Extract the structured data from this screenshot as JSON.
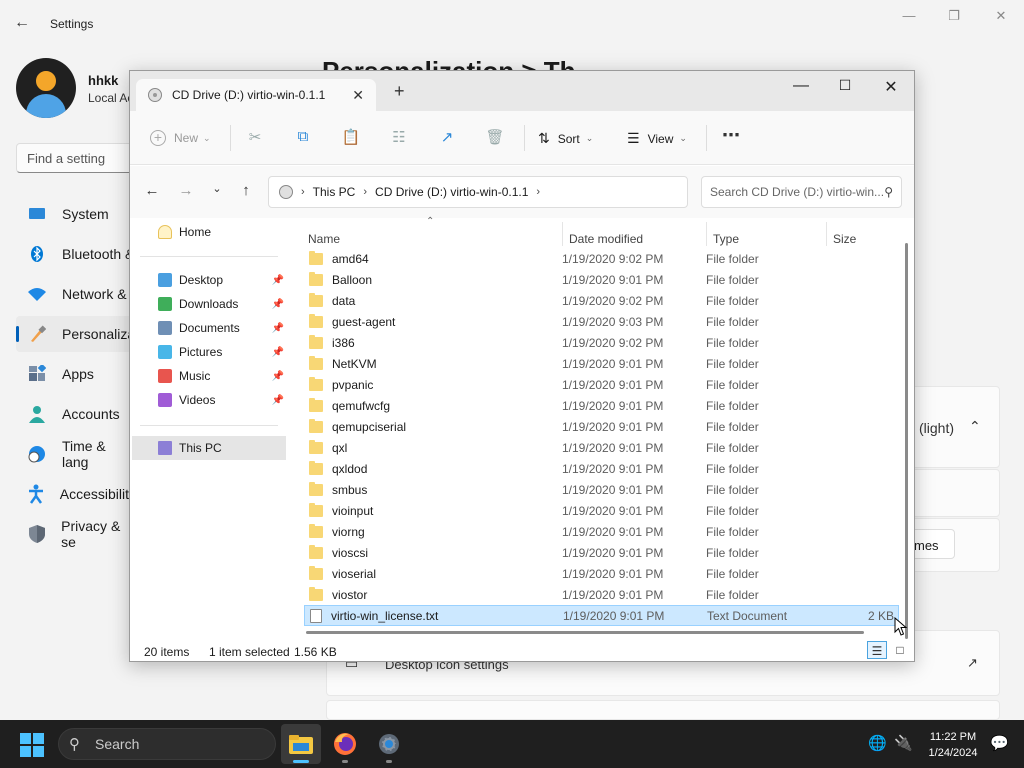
{
  "settings": {
    "title": "Settings",
    "user_name": "hhkk",
    "user_sub": "Local Ac",
    "find_placeholder": "Find a setting",
    "page_heading": "Personalization > Th",
    "nav": [
      {
        "label": "System",
        "icon": "monitor-icon"
      },
      {
        "label": "Bluetooth &",
        "icon": "bluetooth-icon"
      },
      {
        "label": "Network &",
        "icon": "wifi-icon"
      },
      {
        "label": "Personaliza",
        "icon": "brush-icon"
      },
      {
        "label": "Apps",
        "icon": "apps-icon"
      },
      {
        "label": "Accounts",
        "icon": "person-icon"
      },
      {
        "label": "Time & lang",
        "icon": "clock-globe-icon"
      },
      {
        "label": "Accessibility",
        "icon": "accessibility-icon"
      },
      {
        "label": "Privacy & se",
        "icon": "shield-icon"
      }
    ],
    "theme_value": "(light)",
    "themes_button": "mes",
    "desktop_icon_settings": "Desktop icon settings"
  },
  "explorer": {
    "tab_title": "CD Drive (D:) virtio-win-0.1.1",
    "toolbar": {
      "new_label": "New",
      "sort_label": "Sort",
      "view_label": "View"
    },
    "address": {
      "segments": [
        "This PC",
        "CD Drive (D:) virtio-win-0.1.1"
      ]
    },
    "search_placeholder": "Search CD Drive (D:) virtio-win...",
    "nav_pane": {
      "home": "Home",
      "quick": [
        {
          "label": "Desktop",
          "color": "#4a9fe0"
        },
        {
          "label": "Downloads",
          "color": "#3fae5a"
        },
        {
          "label": "Documents",
          "color": "#6f8fb5"
        },
        {
          "label": "Pictures",
          "color": "#48b6e8"
        },
        {
          "label": "Music",
          "color": "#e8554e"
        },
        {
          "label": "Videos",
          "color": "#a05cd6"
        }
      ],
      "this_pc": "This PC"
    },
    "columns": {
      "name": "Name",
      "date": "Date modified",
      "type": "Type",
      "size": "Size"
    },
    "files": [
      {
        "name": "amd64",
        "date": "1/19/2020 9:02 PM",
        "type": "File folder",
        "size": ""
      },
      {
        "name": "Balloon",
        "date": "1/19/2020 9:01 PM",
        "type": "File folder",
        "size": ""
      },
      {
        "name": "data",
        "date": "1/19/2020 9:02 PM",
        "type": "File folder",
        "size": ""
      },
      {
        "name": "guest-agent",
        "date": "1/19/2020 9:03 PM",
        "type": "File folder",
        "size": ""
      },
      {
        "name": "i386",
        "date": "1/19/2020 9:02 PM",
        "type": "File folder",
        "size": ""
      },
      {
        "name": "NetKVM",
        "date": "1/19/2020 9:01 PM",
        "type": "File folder",
        "size": ""
      },
      {
        "name": "pvpanic",
        "date": "1/19/2020 9:01 PM",
        "type": "File folder",
        "size": ""
      },
      {
        "name": "qemufwcfg",
        "date": "1/19/2020 9:01 PM",
        "type": "File folder",
        "size": ""
      },
      {
        "name": "qemupciserial",
        "date": "1/19/2020 9:01 PM",
        "type": "File folder",
        "size": ""
      },
      {
        "name": "qxl",
        "date": "1/19/2020 9:01 PM",
        "type": "File folder",
        "size": ""
      },
      {
        "name": "qxldod",
        "date": "1/19/2020 9:01 PM",
        "type": "File folder",
        "size": ""
      },
      {
        "name": "smbus",
        "date": "1/19/2020 9:01 PM",
        "type": "File folder",
        "size": ""
      },
      {
        "name": "vioinput",
        "date": "1/19/2020 9:01 PM",
        "type": "File folder",
        "size": ""
      },
      {
        "name": "viorng",
        "date": "1/19/2020 9:01 PM",
        "type": "File folder",
        "size": ""
      },
      {
        "name": "vioscsi",
        "date": "1/19/2020 9:01 PM",
        "type": "File folder",
        "size": ""
      },
      {
        "name": "vioserial",
        "date": "1/19/2020 9:01 PM",
        "type": "File folder",
        "size": ""
      },
      {
        "name": "viostor",
        "date": "1/19/2020 9:01 PM",
        "type": "File folder",
        "size": ""
      },
      {
        "name": "virtio-win_license.txt",
        "date": "1/19/2020 9:01 PM",
        "type": "Text Document",
        "size": "2 KB",
        "selected": true
      }
    ],
    "status": {
      "items": "20 items",
      "selected": "1 item selected",
      "size": "1.56 KB"
    }
  },
  "taskbar": {
    "search_label": "Search",
    "time": "11:22 PM",
    "date": "1/24/2024"
  }
}
